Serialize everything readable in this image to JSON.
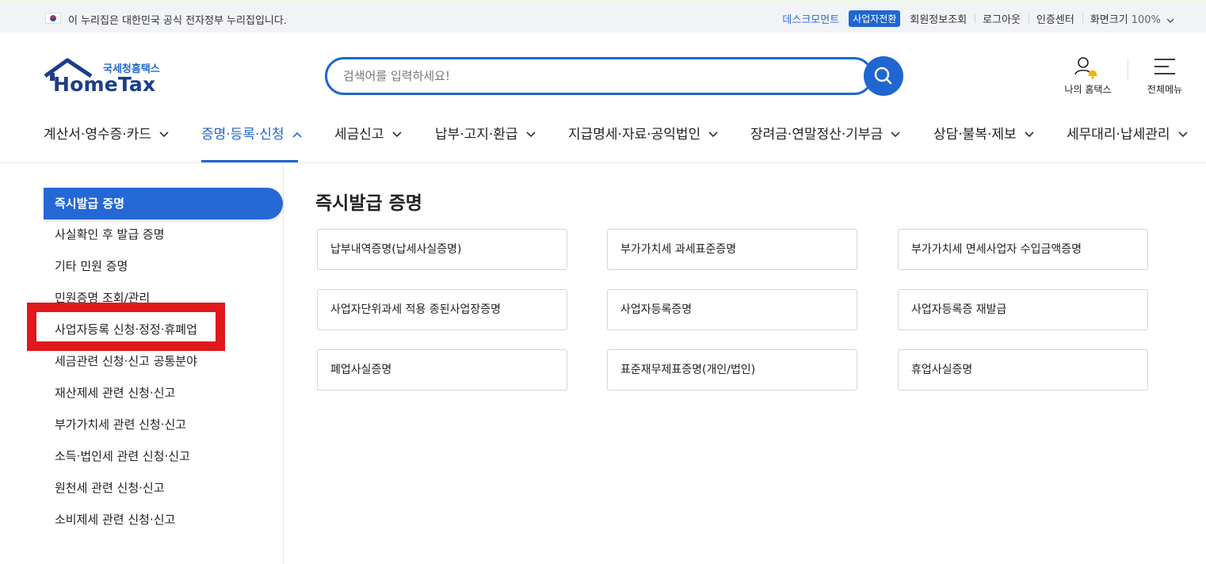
{
  "govbar": {
    "notice": "이 누리집은 대한민국 공식 전자정부 누리집입니다.",
    "links": [
      "데스크모먼트",
      "사업자전환",
      "회원정보조회",
      "로그아웃",
      "인증센터",
      "화면크기"
    ],
    "zoom": "100%"
  },
  "header": {
    "logo_ko": "국세청홈택스",
    "logo_en": "HomeTax",
    "search_placeholder": "검색어를 입력하세요!",
    "my_home_label": "나의 홈택스",
    "all_menu_label": "전체메뉴"
  },
  "gnb": {
    "items": [
      "계산서·영수증·카드",
      "증명·등록·신청",
      "세금신고",
      "납부·고지·환급",
      "지급명세·자료·공익법인",
      "장려금·연말정산·기부금",
      "상담·불복·제보",
      "세무대리·납세관리"
    ]
  },
  "sidebar": {
    "items": [
      "즉시발급 증명",
      "사실확인 후 발급 증명",
      "기타 민원 증명",
      "민원증명 조회/관리",
      "사업자등록 신청·정정·휴폐업",
      "세금관련 신청·신고 공통분야",
      "재산제세 관련 신청·신고",
      "부가가치세 관련 신청·신고",
      "소득·법인세 관련 신청·신고",
      "원천세 관련 신청·신고",
      "소비제세 관련 신청·신고"
    ]
  },
  "content": {
    "title": "즉시발급 증명",
    "cards": [
      "납부내역증명(납세사실증명)",
      "부가가치세 과세표준증명",
      "부가가치세 면세사업자 수입금액증명",
      "사업자단위과세 적용 종된사업장증명",
      "사업자등록증명",
      "사업자등록증 재발급",
      "폐업사실증명",
      "표준재무제표증명(개인/법인)",
      "휴업사실증명"
    ]
  },
  "colors": {
    "brand_blue": "#1f66d1",
    "highlight_red": "#e0191d"
  }
}
